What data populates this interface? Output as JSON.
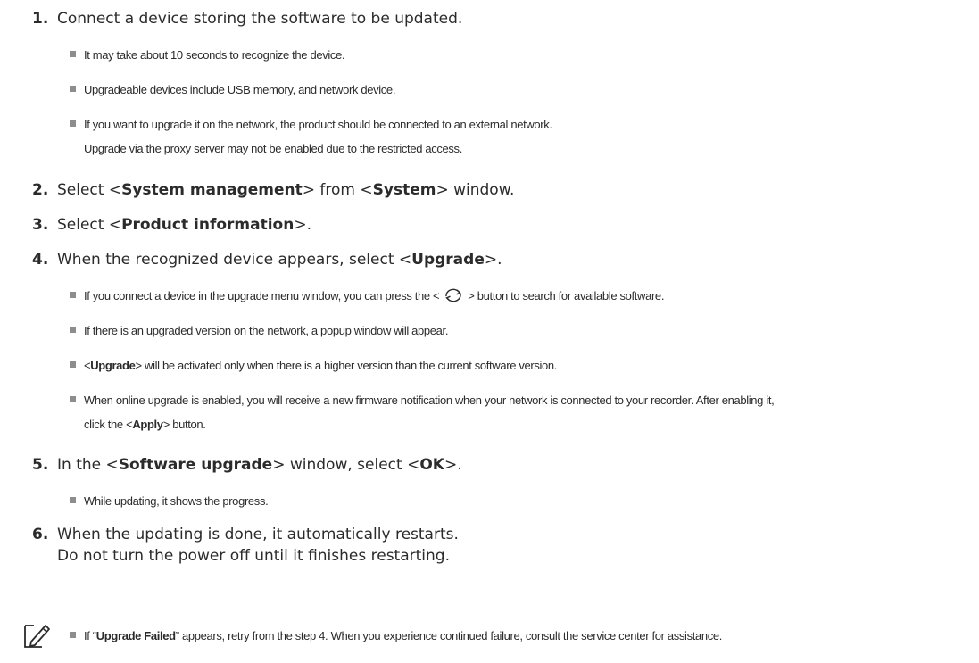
{
  "steps": [
    {
      "num": "1.",
      "text": "Connect a device storing the software to be updated."
    },
    {
      "num": "2.",
      "pre": "Select <",
      "b1": "System management",
      "mid": "> from <",
      "b2": "System",
      "post": "> window."
    },
    {
      "num": "3.",
      "pre": "Select <",
      "b1": "Product information",
      "post": ">."
    },
    {
      "num": "4.",
      "pre": "When the recognized device appears, select <",
      "b1": "Upgrade",
      "post": ">."
    },
    {
      "num": "5.",
      "pre": "In the <",
      "b1": "Software upgrade",
      "mid": "> window, select <",
      "b2": "OK",
      "post": ">."
    },
    {
      "num": "6.",
      "line1": "When the updating is done, it automatically restarts.",
      "line2": "Do not turn the power off until it finishes restarting."
    }
  ],
  "notes1": [
    "It may take about 10 seconds to recognize the device.",
    "Upgradeable devices include USB memory, and network device.",
    "If you want to upgrade it on the network, the product should be connected to an external network."
  ],
  "notes1_cont": "Upgrade via the proxy server may not be enabled due to the restricted access.",
  "notes4": {
    "refresh_pre": "If you connect a device in the upgrade menu window, you can press the <",
    "refresh_post": "> button to search for available software.",
    "popup": "If there is an upgraded version on the network, a popup window will appear.",
    "activated_pre": "<",
    "activated_bold": "Upgrade",
    "activated_post": "> will be activated only when there is a higher version than the current software version.",
    "online_line1": "When online upgrade is enabled, you will receive a new firmware notification when your network is connected to your recorder. After enabling it,",
    "online_cont_pre": "click the <",
    "online_cont_bold": "Apply",
    "online_cont_post": "> button."
  },
  "notes5": [
    "While updating, it shows the progress."
  ],
  "memo": {
    "pre": "If “",
    "bold": "Upgrade Failed",
    "post": "” appears, retry from the step 4. When you experience continued failure, consult the service center for assistance."
  },
  "icons": {
    "refresh": "refresh-arrows-icon",
    "memo": "memo-pencil-icon",
    "bullet": "square-bullet-icon"
  }
}
